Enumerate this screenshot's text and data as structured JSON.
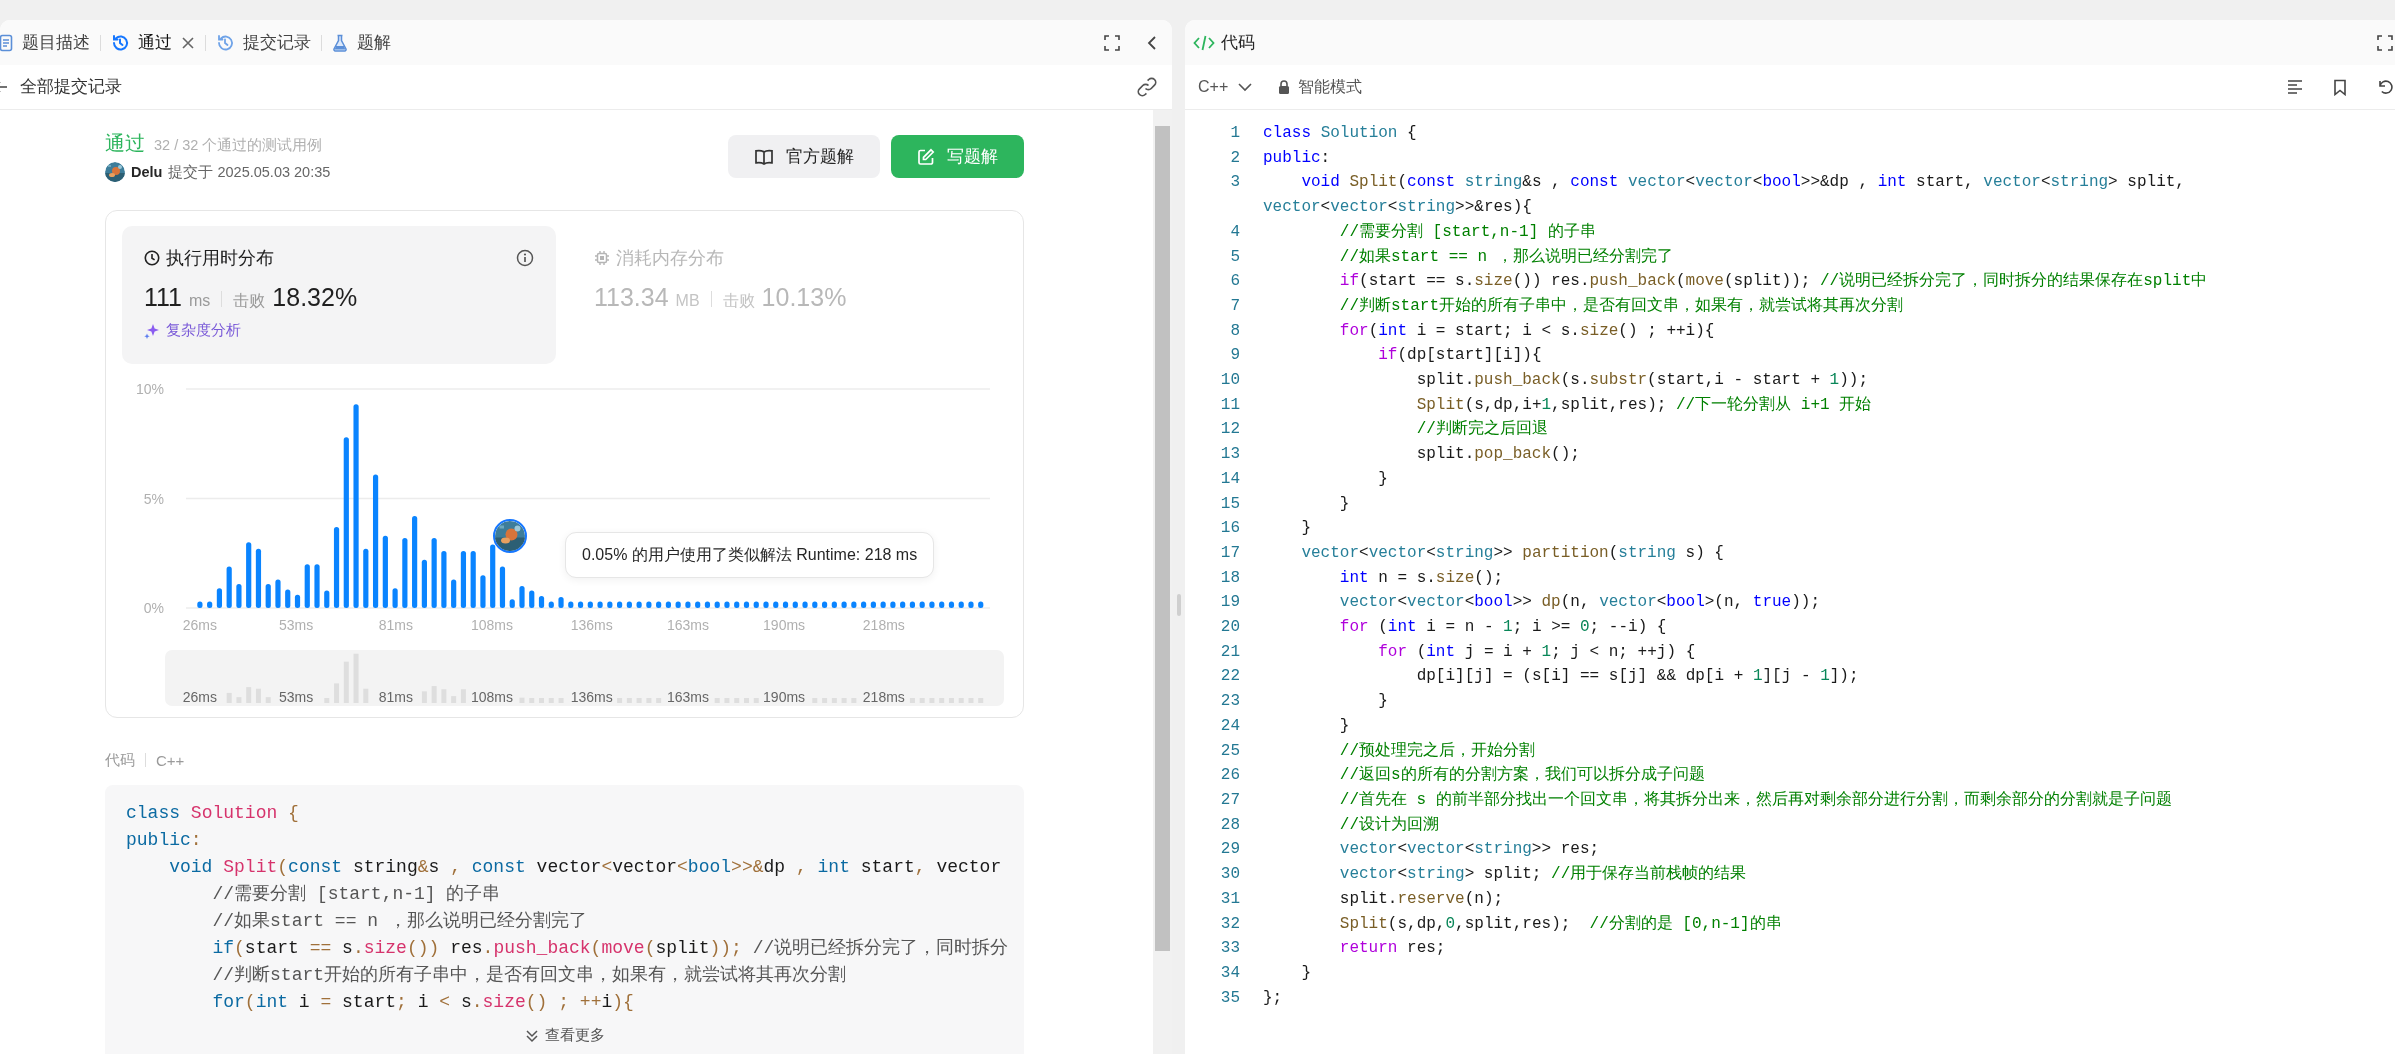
{
  "tabs": [
    {
      "label": "题目描述",
      "selected": false,
      "closable": false
    },
    {
      "label": "通过",
      "selected": true,
      "closable": true
    },
    {
      "label": "提交记录",
      "selected": false,
      "closable": false
    },
    {
      "label": "题解",
      "selected": false,
      "closable": false
    }
  ],
  "back_link": "全部提交记录",
  "result": {
    "status": "通过",
    "tests": "32 / 32 个通过的测试用例",
    "author": "Delu",
    "submitted": "提交于 2025.05.03 20:35",
    "buttons": [
      {
        "label": "官方题解",
        "kind": "secondary"
      },
      {
        "label": "写题解",
        "kind": "primary"
      }
    ]
  },
  "stats": [
    {
      "title": "执行用时分布",
      "selected": true,
      "value": "111",
      "unit": "ms",
      "beats_label": "击败",
      "beats": "18.32%",
      "link": "复杂度分析"
    },
    {
      "title": "消耗内存分布",
      "selected": false,
      "value": "113.34",
      "unit": "MB",
      "beats_label": "击败",
      "beats": "10.13%"
    }
  ],
  "runtime_chart": {
    "chart_data": {
      "type": "bar",
      "ylim": [
        0,
        10
      ],
      "xlim": [
        22.1,
        247.8
      ],
      "yticks": [
        {
          "value": 0,
          "label": "0%"
        },
        {
          "value": 5,
          "label": "5%"
        },
        {
          "value": 10,
          "label": "10%"
        }
      ],
      "xticks": [
        {
          "value": 26,
          "label": "26ms"
        },
        {
          "value": 53,
          "label": "53ms"
        },
        {
          "value": 81,
          "label": "81ms"
        },
        {
          "value": 108,
          "label": "108ms"
        },
        {
          "value": 136,
          "label": "136ms"
        },
        {
          "value": 163,
          "label": "163ms"
        },
        {
          "value": 190,
          "label": "190ms"
        },
        {
          "value": 218,
          "label": "218ms"
        }
      ],
      "x": [
        26,
        28.74,
        31.48,
        34.22,
        36.96,
        39.7,
        42.44,
        45.18,
        47.92,
        50.66,
        53.4,
        56.14,
        58.88,
        61.62,
        64.36,
        67.1,
        69.84,
        72.58,
        75.32,
        78.06,
        80.8,
        83.54,
        86.28,
        89.02,
        91.76,
        94.5,
        97.24,
        99.98,
        102.72,
        105.46,
        108.2,
        110.94,
        113.68,
        116.42,
        119.16,
        121.9,
        124.64,
        127.38,
        130.12,
        132.86,
        135.6,
        138.34,
        141.08,
        143.82,
        146.56,
        149.3,
        152.04,
        154.78,
        157.52,
        160.26,
        163,
        165.74,
        168.48,
        171.22,
        173.96,
        176.7,
        179.44,
        182.18,
        184.92,
        187.66,
        190.4,
        193.14,
        195.88,
        198.62,
        201.36,
        204.1,
        206.84,
        209.58,
        212.32,
        215.06,
        217.8,
        220.54,
        223.28,
        226.02,
        228.76,
        231.5,
        234.24,
        236.98,
        239.72,
        242.46,
        245.2
      ],
      "values": [
        0.3,
        0.3,
        0.9,
        1.9,
        1.1,
        3.0,
        2.7,
        1.1,
        1.3,
        0.85,
        0.6,
        2.0,
        2.0,
        0.8,
        3.7,
        7.8,
        9.3,
        2.7,
        6.1,
        3.3,
        0.9,
        3.2,
        4.2,
        2.2,
        3.2,
        2.6,
        1.3,
        2.6,
        2.6,
        1.5,
        2.9,
        1.9,
        0.4,
        1.0,
        0.8,
        0.55,
        0.3,
        0.5,
        0.3,
        0.3,
        0.3,
        0.3,
        0.3,
        0.3,
        0.3,
        0.3,
        0.3,
        0.3,
        0.3,
        0.3,
        0.3,
        0.3,
        0.3,
        0.3,
        0.3,
        0.3,
        0.3,
        0.3,
        0.3,
        0.3,
        0.3,
        0.3,
        0.3,
        0.3,
        0.3,
        0.3,
        0.3,
        0.3,
        0.3,
        0.3,
        0.3,
        0.3,
        0.3,
        0.3,
        0.3,
        0.3,
        0.3,
        0.3,
        0.3,
        0.3,
        0.3
      ]
    },
    "tooltip": "0.05% 的用户使用了类似解法 Runtime: 218 ms",
    "overview_labels": [
      "26ms",
      "53ms",
      "81ms",
      "108ms",
      "136ms",
      "163ms",
      "190ms",
      "218ms"
    ]
  },
  "code_preview": {
    "label": "代码",
    "language": "C++",
    "more": "查看更多",
    "lines": [
      "class Solution {",
      "public:",
      "    void Split(const string&s , const vector<vector<bool>>&dp , int start, vector",
      "        //需要分割 [start,n-1] 的子串",
      "        //如果start == n ，那么说明已经分割完了",
      "        if(start == s.size()) res.push_back(move(split)); //说明已经拆分完了，同时拆分",
      "        //判断start开始的所有子串中，是否有回文串，如果有，就尝试将其再次分割",
      "        for(int i = start; i < s.size() ; ++i){"
    ]
  },
  "editor": {
    "title": "代码",
    "language": "C++",
    "mode": "智能模式",
    "lines": [
      {
        "no": "1",
        "text": "class Solution {"
      },
      {
        "no": "2",
        "text": "public:"
      },
      {
        "no": "3",
        "text": "    void Split(const string&s , const vector<vector<bool>>&dp , int start, vector<string> split, vector<vector<string>>&res){"
      },
      {
        "no": "4",
        "text": "        //需要分割 [start,n-1] 的子串"
      },
      {
        "no": "5",
        "text": "        //如果start == n ，那么说明已经分割完了"
      },
      {
        "no": "6",
        "text": "        if(start == s.size()) res.push_back(move(split)); //说明已经拆分完了，同时拆分的结果保存在split中"
      },
      {
        "no": "7",
        "text": "        //判断start开始的所有子串中，是否有回文串，如果有，就尝试将其再次分割"
      },
      {
        "no": "8",
        "text": "        for(int i = start; i < s.size() ; ++i){"
      },
      {
        "no": "9",
        "text": "            if(dp[start][i]){"
      },
      {
        "no": "10",
        "text": "                split.push_back(s.substr(start,i - start + 1));"
      },
      {
        "no": "11",
        "text": "                Split(s,dp,i+1,split,res); //下一轮分割从 i+1 开始"
      },
      {
        "no": "12",
        "text": "                //判断完之后回退"
      },
      {
        "no": "13",
        "text": "                split.pop_back();"
      },
      {
        "no": "14",
        "text": "            }"
      },
      {
        "no": "15",
        "text": "        }"
      },
      {
        "no": "16",
        "text": "    }"
      },
      {
        "no": "17",
        "text": "    vector<vector<string>> partition(string s) {"
      },
      {
        "no": "18",
        "text": "        int n = s.size();"
      },
      {
        "no": "19",
        "text": "        vector<vector<bool>> dp(n, vector<bool>(n, true));"
      },
      {
        "no": "20",
        "text": "        for (int i = n - 1; i >= 0; --i) {"
      },
      {
        "no": "21",
        "text": "            for (int j = i + 1; j < n; ++j) {"
      },
      {
        "no": "22",
        "text": "                dp[i][j] = (s[i] == s[j] && dp[i + 1][j - 1]);"
      },
      {
        "no": "23",
        "text": "            }"
      },
      {
        "no": "24",
        "text": "        }"
      },
      {
        "no": "25",
        "text": "        //预处理完之后，开始分割"
      },
      {
        "no": "26",
        "text": "        //返回s的所有的分割方案，我们可以拆分成子问题"
      },
      {
        "no": "27",
        "text": "        //首先在 s 的前半部分找出一个回文串，将其拆分出来，然后再对剩余部分进行分割，而剩余部分的分割就是子问题"
      },
      {
        "no": "28",
        "text": "        //设计为回溯"
      },
      {
        "no": "29",
        "text": "        vector<vector<string>> res;"
      },
      {
        "no": "30",
        "text": "        vector<string> split; //用于保存当前栈帧的结果"
      },
      {
        "no": "31",
        "text": "        split.reserve(n);"
      },
      {
        "no": "32",
        "text": "        Split(s,dp,0,split,res);  //分割的是 [0,n-1]的串"
      },
      {
        "no": "33",
        "text": "        return res;"
      },
      {
        "no": "34",
        "text": "    }"
      },
      {
        "no": "35",
        "text": "};"
      }
    ]
  }
}
